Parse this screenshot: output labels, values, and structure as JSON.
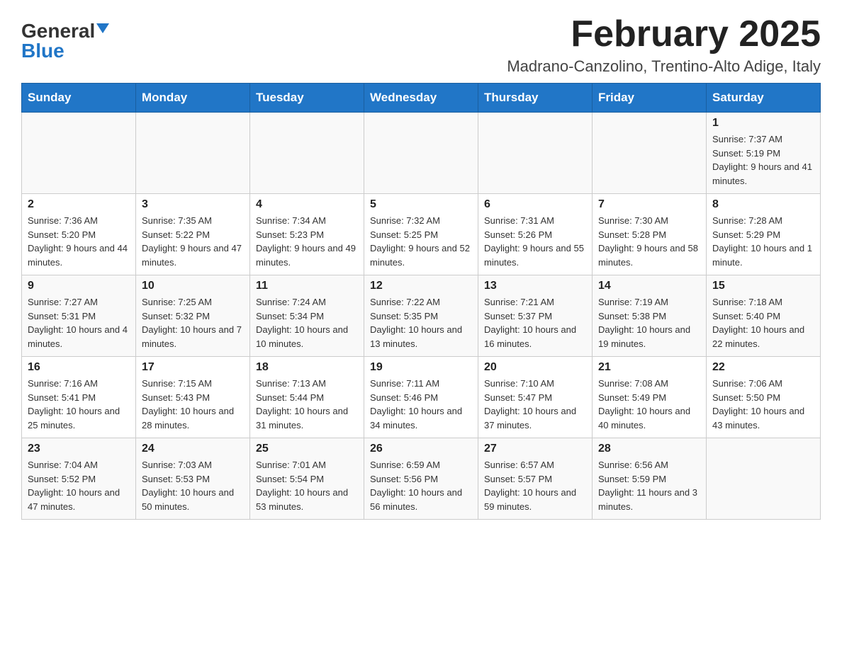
{
  "header": {
    "logo_general": "General",
    "logo_blue": "Blue",
    "month_title": "February 2025",
    "location": "Madrano-Canzolino, Trentino-Alto Adige, Italy"
  },
  "weekdays": [
    "Sunday",
    "Monday",
    "Tuesday",
    "Wednesday",
    "Thursday",
    "Friday",
    "Saturday"
  ],
  "weeks": [
    [
      {
        "day": "",
        "info": ""
      },
      {
        "day": "",
        "info": ""
      },
      {
        "day": "",
        "info": ""
      },
      {
        "day": "",
        "info": ""
      },
      {
        "day": "",
        "info": ""
      },
      {
        "day": "",
        "info": ""
      },
      {
        "day": "1",
        "info": "Sunrise: 7:37 AM\nSunset: 5:19 PM\nDaylight: 9 hours and 41 minutes."
      }
    ],
    [
      {
        "day": "2",
        "info": "Sunrise: 7:36 AM\nSunset: 5:20 PM\nDaylight: 9 hours and 44 minutes."
      },
      {
        "day": "3",
        "info": "Sunrise: 7:35 AM\nSunset: 5:22 PM\nDaylight: 9 hours and 47 minutes."
      },
      {
        "day": "4",
        "info": "Sunrise: 7:34 AM\nSunset: 5:23 PM\nDaylight: 9 hours and 49 minutes."
      },
      {
        "day": "5",
        "info": "Sunrise: 7:32 AM\nSunset: 5:25 PM\nDaylight: 9 hours and 52 minutes."
      },
      {
        "day": "6",
        "info": "Sunrise: 7:31 AM\nSunset: 5:26 PM\nDaylight: 9 hours and 55 minutes."
      },
      {
        "day": "7",
        "info": "Sunrise: 7:30 AM\nSunset: 5:28 PM\nDaylight: 9 hours and 58 minutes."
      },
      {
        "day": "8",
        "info": "Sunrise: 7:28 AM\nSunset: 5:29 PM\nDaylight: 10 hours and 1 minute."
      }
    ],
    [
      {
        "day": "9",
        "info": "Sunrise: 7:27 AM\nSunset: 5:31 PM\nDaylight: 10 hours and 4 minutes."
      },
      {
        "day": "10",
        "info": "Sunrise: 7:25 AM\nSunset: 5:32 PM\nDaylight: 10 hours and 7 minutes."
      },
      {
        "day": "11",
        "info": "Sunrise: 7:24 AM\nSunset: 5:34 PM\nDaylight: 10 hours and 10 minutes."
      },
      {
        "day": "12",
        "info": "Sunrise: 7:22 AM\nSunset: 5:35 PM\nDaylight: 10 hours and 13 minutes."
      },
      {
        "day": "13",
        "info": "Sunrise: 7:21 AM\nSunset: 5:37 PM\nDaylight: 10 hours and 16 minutes."
      },
      {
        "day": "14",
        "info": "Sunrise: 7:19 AM\nSunset: 5:38 PM\nDaylight: 10 hours and 19 minutes."
      },
      {
        "day": "15",
        "info": "Sunrise: 7:18 AM\nSunset: 5:40 PM\nDaylight: 10 hours and 22 minutes."
      }
    ],
    [
      {
        "day": "16",
        "info": "Sunrise: 7:16 AM\nSunset: 5:41 PM\nDaylight: 10 hours and 25 minutes."
      },
      {
        "day": "17",
        "info": "Sunrise: 7:15 AM\nSunset: 5:43 PM\nDaylight: 10 hours and 28 minutes."
      },
      {
        "day": "18",
        "info": "Sunrise: 7:13 AM\nSunset: 5:44 PM\nDaylight: 10 hours and 31 minutes."
      },
      {
        "day": "19",
        "info": "Sunrise: 7:11 AM\nSunset: 5:46 PM\nDaylight: 10 hours and 34 minutes."
      },
      {
        "day": "20",
        "info": "Sunrise: 7:10 AM\nSunset: 5:47 PM\nDaylight: 10 hours and 37 minutes."
      },
      {
        "day": "21",
        "info": "Sunrise: 7:08 AM\nSunset: 5:49 PM\nDaylight: 10 hours and 40 minutes."
      },
      {
        "day": "22",
        "info": "Sunrise: 7:06 AM\nSunset: 5:50 PM\nDaylight: 10 hours and 43 minutes."
      }
    ],
    [
      {
        "day": "23",
        "info": "Sunrise: 7:04 AM\nSunset: 5:52 PM\nDaylight: 10 hours and 47 minutes."
      },
      {
        "day": "24",
        "info": "Sunrise: 7:03 AM\nSunset: 5:53 PM\nDaylight: 10 hours and 50 minutes."
      },
      {
        "day": "25",
        "info": "Sunrise: 7:01 AM\nSunset: 5:54 PM\nDaylight: 10 hours and 53 minutes."
      },
      {
        "day": "26",
        "info": "Sunrise: 6:59 AM\nSunset: 5:56 PM\nDaylight: 10 hours and 56 minutes."
      },
      {
        "day": "27",
        "info": "Sunrise: 6:57 AM\nSunset: 5:57 PM\nDaylight: 10 hours and 59 minutes."
      },
      {
        "day": "28",
        "info": "Sunrise: 6:56 AM\nSunset: 5:59 PM\nDaylight: 11 hours and 3 minutes."
      },
      {
        "day": "",
        "info": ""
      }
    ]
  ]
}
